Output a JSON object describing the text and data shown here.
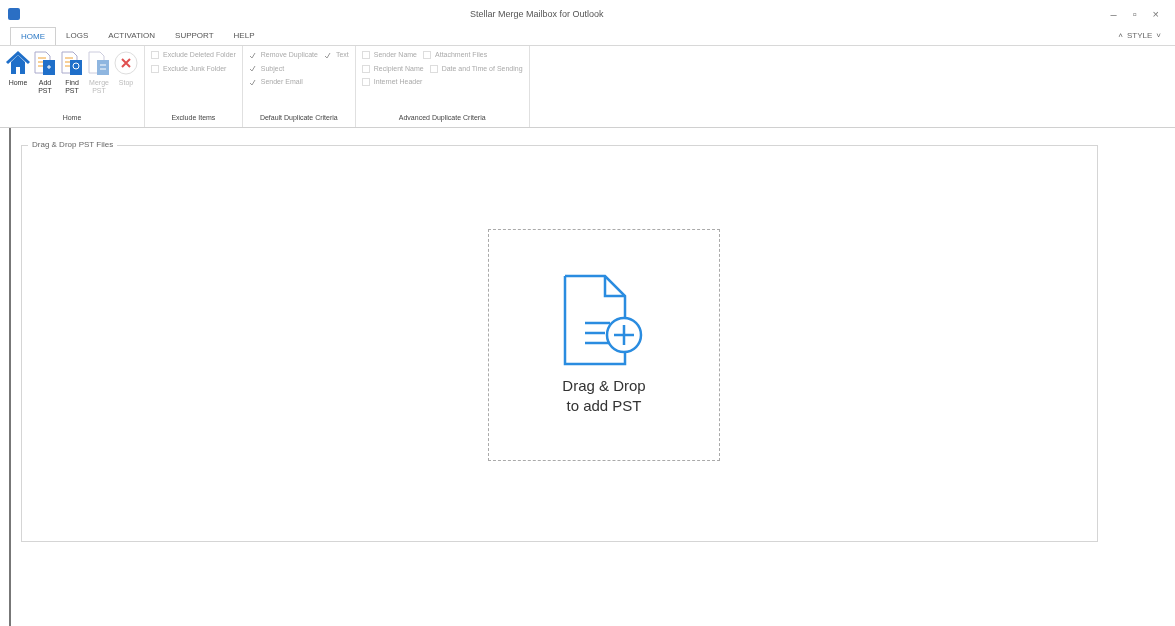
{
  "window": {
    "title": "Stellar Merge Mailbox for Outlook",
    "controls": [
      "–",
      "▫",
      "×"
    ]
  },
  "tabs": [
    {
      "label": "HOME",
      "selected": true
    },
    {
      "label": "LOGS",
      "selected": false
    },
    {
      "label": "ACTIVATION",
      "selected": false
    },
    {
      "label": "SUPPORT",
      "selected": false
    },
    {
      "label": "HELP",
      "selected": false
    }
  ],
  "style_menu": {
    "label": "STYLE",
    "caret": "˅",
    "collapse": "˄"
  },
  "ribbon": {
    "groups": [
      {
        "kind": "buttons",
        "label": "Home",
        "buttons": [
          {
            "lines": [
              "Home"
            ],
            "disabled": false
          },
          {
            "lines": [
              "Add",
              "PST"
            ],
            "disabled": false
          },
          {
            "lines": [
              "Find",
              "PST"
            ],
            "disabled": false
          },
          {
            "lines": [
              "Merge",
              "PST"
            ],
            "disabled": true
          },
          {
            "lines": [
              "Stop"
            ],
            "disabled": true
          }
        ]
      },
      {
        "kind": "checks",
        "label": "Exclude Items",
        "rows": [
          [
            {
              "label": "Exclude Deleted Folder",
              "checked": false,
              "disabled": true
            }
          ],
          [
            {
              "label": "Exclude Junk Folder",
              "checked": false,
              "disabled": true
            }
          ]
        ]
      },
      {
        "kind": "checks",
        "label": "Default Duplicate Criteria",
        "rows": [
          [
            {
              "label": "Remove Duplicate",
              "checked": true,
              "disabled": true
            },
            {
              "label": "Text",
              "checked": true,
              "disabled": true
            }
          ],
          [
            {
              "label": "Subject",
              "checked": true,
              "disabled": true
            }
          ],
          [
            {
              "label": "Sender Email",
              "checked": true,
              "disabled": true
            }
          ]
        ]
      },
      {
        "kind": "checks",
        "label": "Advanced Duplicate Criteria",
        "rows": [
          [
            {
              "label": "Sender Name",
              "checked": false,
              "disabled": true
            },
            {
              "label": "Attachment Files",
              "checked": false,
              "disabled": true
            }
          ],
          [
            {
              "label": "Recipient Name",
              "checked": false,
              "disabled": true
            },
            {
              "label": "Date and Time of Sending",
              "checked": false,
              "disabled": true
            }
          ],
          [
            {
              "label": "Internet Header",
              "checked": false,
              "disabled": true
            }
          ]
        ]
      }
    ]
  },
  "panel": {
    "legend": "Drag & Drop PST Files",
    "drop_zone": {
      "lines": [
        "Drag & Drop",
        "to add PST"
      ]
    }
  }
}
